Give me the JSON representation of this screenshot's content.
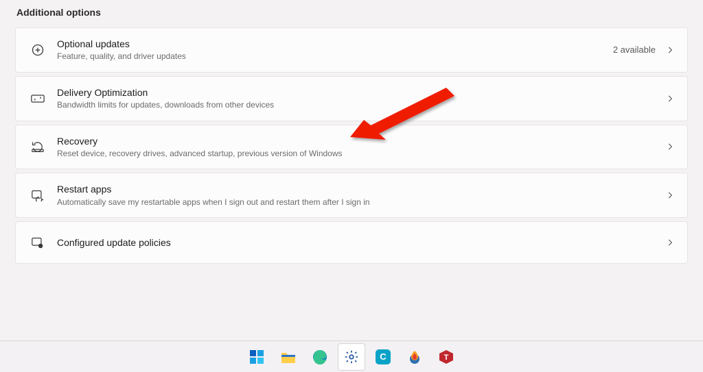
{
  "section_title": "Additional options",
  "items": [
    {
      "title": "Optional updates",
      "desc": "Feature, quality, and driver updates",
      "badge": "2 available",
      "icon": "plus-circle"
    },
    {
      "title": "Delivery Optimization",
      "desc": "Bandwidth limits for updates, downloads from other devices",
      "badge": "",
      "icon": "delivery"
    },
    {
      "title": "Recovery",
      "desc": "Reset device, recovery drives, advanced startup, previous version of Windows",
      "badge": "",
      "icon": "recovery"
    },
    {
      "title": "Restart apps",
      "desc": "Automatically save my restartable apps when I sign out and restart them after I sign in",
      "badge": "",
      "icon": "restart-apps"
    },
    {
      "title": "Configured update policies",
      "desc": "",
      "badge": "",
      "icon": "update-policies"
    }
  ],
  "taskbar": {
    "start": "Start",
    "explorer": "File Explorer",
    "edge": "Microsoft Edge",
    "settings": "Settings",
    "app_c": "C",
    "app_flame": "App",
    "app_t": "T"
  },
  "annotation": {
    "arrow": true
  }
}
